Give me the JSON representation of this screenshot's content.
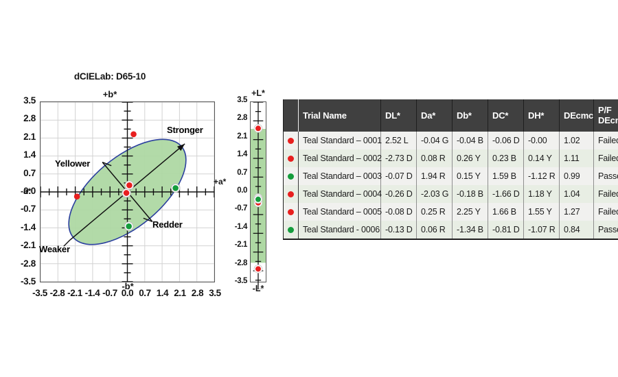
{
  "chart_data": {
    "type": "scatter",
    "title": "dCIELab: D65-10",
    "xlabel": "",
    "ylabel": "",
    "xlim": [
      -3.5,
      3.5
    ],
    "ylim": [
      -3.5,
      3.5
    ],
    "grid": true,
    "axis_names": {
      "top": "+b*",
      "bottom": "-b*",
      "left": "-a*",
      "right": "+a*",
      "bar_top": "+L*",
      "bar_bottom": "-L*"
    },
    "tick_labels_y": [
      "3.5",
      "2.8",
      "2.1",
      "1.4",
      "0.7",
      "0.0",
      "-0.7",
      "-1.4",
      "-2.1",
      "-2.8",
      "-3.5"
    ],
    "tick_labels_x": [
      "-3.5",
      "-2.8",
      "-2.1",
      "-1.4",
      "-0.7",
      "0.0",
      "0.7",
      "1.4",
      "2.1",
      "2.8",
      "3.5"
    ],
    "tick_values": [
      3.5,
      2.8,
      2.1,
      1.4,
      0.7,
      0.0,
      -0.7,
      -1.4,
      -2.1,
      -2.8,
      -3.5
    ],
    "direction_annotations": [
      {
        "label": "Stronger",
        "position": "upper-right"
      },
      {
        "label": "Yellower",
        "position": "upper-left"
      },
      {
        "label": "Redder",
        "position": "lower-right"
      },
      {
        "label": "Weaker",
        "position": "lower-left"
      }
    ],
    "tolerance_ellipse": {
      "center_a": 0.0,
      "center_b": 0.0,
      "semi_major": 2.85,
      "semi_minor": 1.35,
      "angle_deg": 40,
      "fill": "#aed8a3",
      "stroke": "#2b3f9e"
    },
    "series": [
      {
        "name": "ab-points",
        "points": [
          {
            "a": -0.04,
            "b": -0.04,
            "color": "red",
            "trial": "Teal Standard – 0001"
          },
          {
            "a": 0.08,
            "b": 0.26,
            "color": "red",
            "trial": "Teal Standard – 0002"
          },
          {
            "a": 1.94,
            "b": 0.15,
            "color": "green",
            "trial": "Teal Standard – 0003"
          },
          {
            "a": -2.03,
            "b": -0.18,
            "color": "red",
            "trial": "Teal Standard – 0004"
          },
          {
            "a": 0.25,
            "b": 2.25,
            "color": "red",
            "trial": "Teal Standard – 0005"
          },
          {
            "a": 0.06,
            "b": -1.34,
            "color": "green",
            "trial": "Teal Standard - 0006"
          }
        ]
      }
    ],
    "lightness_bar": {
      "tolerance_min": -2.5,
      "tolerance_max": 2.5,
      "fill": "#aed8a3",
      "points": [
        {
          "L": 2.52,
          "color": "red",
          "trial": "Teal Standard – 0001"
        },
        {
          "L": -2.73,
          "color": "red",
          "trial": "Teal Standard – 0002"
        },
        {
          "L": -0.07,
          "color": "green",
          "trial": "Teal Standard – 0003"
        },
        {
          "L": -0.26,
          "color": "red",
          "trial": "Teal Standard – 0004"
        },
        {
          "L": -0.08,
          "color": "red",
          "trial": "Teal Standard – 0005"
        },
        {
          "L": -0.13,
          "color": "green",
          "trial": "Teal Standard - 0006"
        }
      ]
    }
  },
  "colors": {
    "pass_dot": "#149c3c",
    "fail_dot": "#e81f1f",
    "fail_text": "#ee2222",
    "ellipse_fill": "#aed8a3",
    "ellipse_stroke": "#2b3f9e",
    "header_bg": "#404040"
  },
  "table": {
    "headers": [
      "",
      "Trial Name",
      "DL*",
      "Da*",
      "Db*",
      "DC*",
      "DH*",
      "DEcmc",
      "P/F DEcmc"
    ],
    "header_pf_line1": "P/F",
    "header_pf_line2": "DEcmc",
    "rows": [
      {
        "status": "fail",
        "trial_name": "Teal Standard – 0001",
        "dl": "2.52 L",
        "da": "-0.04 G",
        "db": "-0.04 B",
        "dc": "-0.06 D",
        "dh": "-0.00",
        "decmc": "1.02",
        "pf": "Failed"
      },
      {
        "status": "fail",
        "trial_name": "Teal Standard – 0002",
        "dl": "-2.73 D",
        "da": "0.08 R",
        "db": "0.26 Y",
        "dc": "0.23 B",
        "dh": "0.14 Y",
        "decmc": "1.11",
        "pf": "Failed"
      },
      {
        "status": "pass",
        "trial_name": "Teal Standard – 0003",
        "dl": "-0.07 D",
        "da": "1.94 R",
        "db": "0.15 Y",
        "dc": "1.59 B",
        "dh": "-1.12 R",
        "decmc": "0.99",
        "pf": "Passed"
      },
      {
        "status": "fail",
        "trial_name": "Teal Standard – 0004",
        "dl": "-0.26 D",
        "da": "-2.03 G",
        "db": "-0.18 B",
        "dc": "-1.66 D",
        "dh": "1.18 Y",
        "decmc": "1.04",
        "pf": "Failed"
      },
      {
        "status": "fail",
        "trial_name": "Teal Standard – 0005",
        "dl": "-0.08 D",
        "da": "0.25 R",
        "db": "2.25 Y",
        "dc": "1.66 B",
        "dh": "1.55 Y",
        "decmc": "1.27",
        "pf": "Failed"
      },
      {
        "status": "pass",
        "trial_name": "Teal Standard - 0006",
        "dl": "-0.13 D",
        "da": "0.06 R",
        "db": "-1.34 B",
        "dc": "-0.81 D",
        "dh": "-1.07 R",
        "decmc": "0.84",
        "pf": "Passed"
      }
    ]
  }
}
